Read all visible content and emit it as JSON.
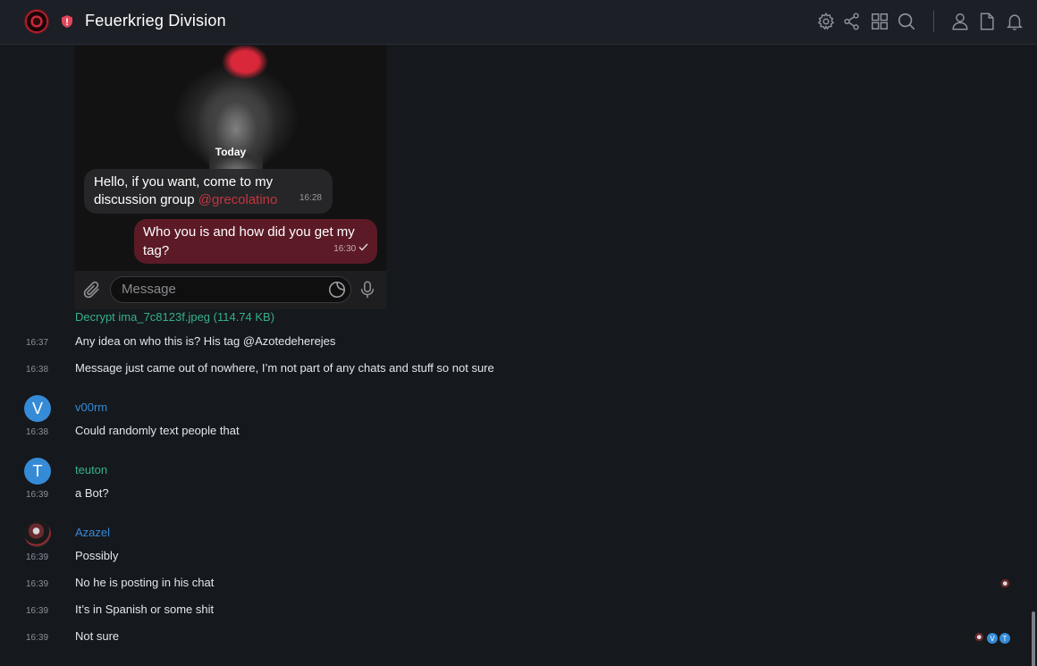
{
  "header": {
    "room_name": "Feuerkrieg Division",
    "icons": [
      "settings-icon",
      "share-icon",
      "apps-grid-icon",
      "search-icon",
      "people-icon",
      "files-icon",
      "notifications-icon"
    ]
  },
  "image_message": {
    "day_label": "Today",
    "incoming": {
      "text": "Hello, if you want, come to my discussion group",
      "mention": "@grecolatino",
      "time": "16:28"
    },
    "outgoing": {
      "text": "Who you is and how did you get my tag?",
      "time": "16:30"
    },
    "composer_placeholder": "Message",
    "decrypt_label": "Decrypt ima_7c8123f.jpeg (114.74 KB)"
  },
  "messages": [
    {
      "time": "16:37",
      "text": "Any idea on who this is? His tag @Azotedeherejes"
    },
    {
      "time": "16:38",
      "text": "Message just came out of nowhere, I’m not part of any chats and stuff so not sure"
    }
  ],
  "groups": [
    {
      "sender": "v00rm",
      "avatar_letter": "V",
      "color": "#368bd6",
      "messages": [
        {
          "time": "16:38",
          "text": "Could randomly text people that"
        }
      ]
    },
    {
      "sender": "teuton",
      "avatar_letter": "T",
      "color": "#36b08a",
      "messages": [
        {
          "time": "16:39",
          "text": "a Bot?"
        }
      ]
    },
    {
      "sender": "Azazel",
      "avatar_letter": "",
      "color": "#368bd6",
      "messages": [
        {
          "time": "16:39",
          "text": "Possibly"
        },
        {
          "time": "16:39",
          "text": "No he is posting in his chat"
        },
        {
          "time": "16:39",
          "text": "It’s in Spanish or some shit"
        },
        {
          "time": "16:39",
          "text": "Not sure"
        }
      ]
    }
  ],
  "read_receipts": {
    "row_posting": [
      "avatar-image"
    ],
    "row_not_sure": [
      "avatar-image",
      "V",
      "T"
    ]
  },
  "colors": {
    "accent_link": "#36b08a",
    "sender_blue": "#368bd6",
    "mention_red": "#c4343f",
    "background": "#15181d"
  }
}
